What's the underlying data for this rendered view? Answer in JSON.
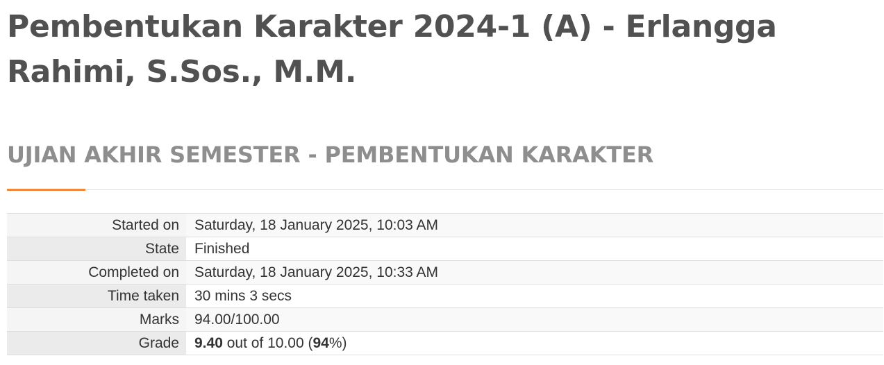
{
  "course": {
    "title": "Pembentukan Karakter 2024-1 (A) - Erlangga Rahimi, S.Sos., M.M."
  },
  "quiz": {
    "title": "UJIAN AKHIR SEMESTER - PEMBENTUKAN KARAKTER"
  },
  "accent_color": "#f0883c",
  "summary": {
    "started_on": {
      "label": "Started on",
      "value": "Saturday, 18 January 2025, 10:03 AM"
    },
    "state": {
      "label": "State",
      "value": "Finished"
    },
    "completed_on": {
      "label": "Completed on",
      "value": "Saturday, 18 January 2025, 10:33 AM"
    },
    "time_taken": {
      "label": "Time taken",
      "value": "30 mins 3 secs"
    },
    "marks": {
      "label": "Marks",
      "value": "94.00/100.00"
    },
    "grade": {
      "label": "Grade",
      "score": "9.40",
      "out_of_text": "out of 10.00",
      "percent": "94"
    }
  }
}
